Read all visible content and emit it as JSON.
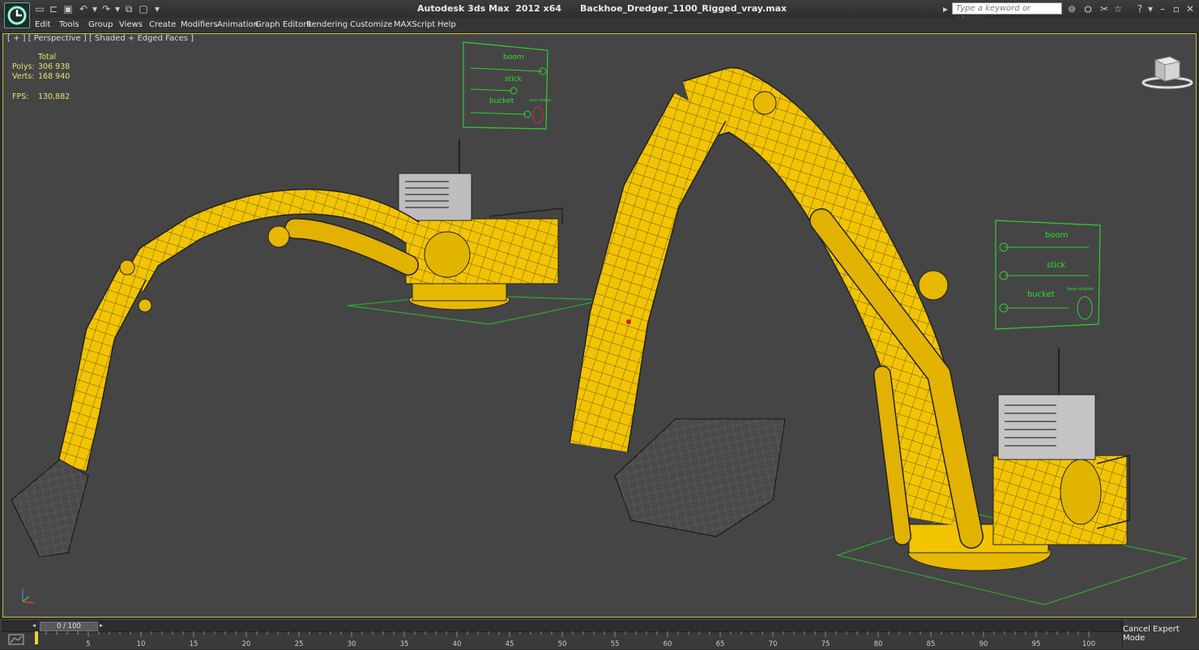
{
  "window": {
    "title": "Autodesk 3ds Max  2012 x64      Backhoe_Dredger_1100_Rigged_vray.max"
  },
  "search": {
    "placeholder": "Type a keyword or phrase"
  },
  "menu": [
    {
      "label": "Edit"
    },
    {
      "label": "Tools"
    },
    {
      "label": "Group"
    },
    {
      "label": "Views"
    },
    {
      "label": "Create"
    },
    {
      "label": "Modifiers"
    },
    {
      "label": "Animation"
    },
    {
      "label": "Graph Editors"
    },
    {
      "label": "Rendering"
    },
    {
      "label": "Customize"
    },
    {
      "label": "MAXScript"
    },
    {
      "label": "Help"
    }
  ],
  "viewport": {
    "label": "[ + ] [ Perspective ] [ Shaded + Edged Faces ]",
    "stats": {
      "total_label": "Total",
      "polys_label": "Polys:",
      "polys_value": "306 938",
      "verts_label": "Verts:",
      "verts_value": "168 940",
      "fps_label": "FPS:",
      "fps_value": "130,882"
    },
    "control_panel": {
      "labels": [
        "boom",
        "stick",
        "bucket"
      ],
      "small_label": "base rotation"
    }
  },
  "timeline": {
    "frame_display": "0 / 100",
    "ticks": [
      "5",
      "10",
      "15",
      "20",
      "25",
      "30",
      "35",
      "40",
      "45",
      "50",
      "55",
      "60",
      "65",
      "70",
      "75",
      "80",
      "85",
      "90",
      "95",
      "100"
    ]
  },
  "cancel_expert_label": "Cancel Expert Mode",
  "colors": {
    "viewport_bg": "#454545",
    "active_border": "#c9c23a",
    "model_yellow": "#f2c400",
    "helper_green": "#33cc33",
    "stat_text": "#e8e06e"
  }
}
